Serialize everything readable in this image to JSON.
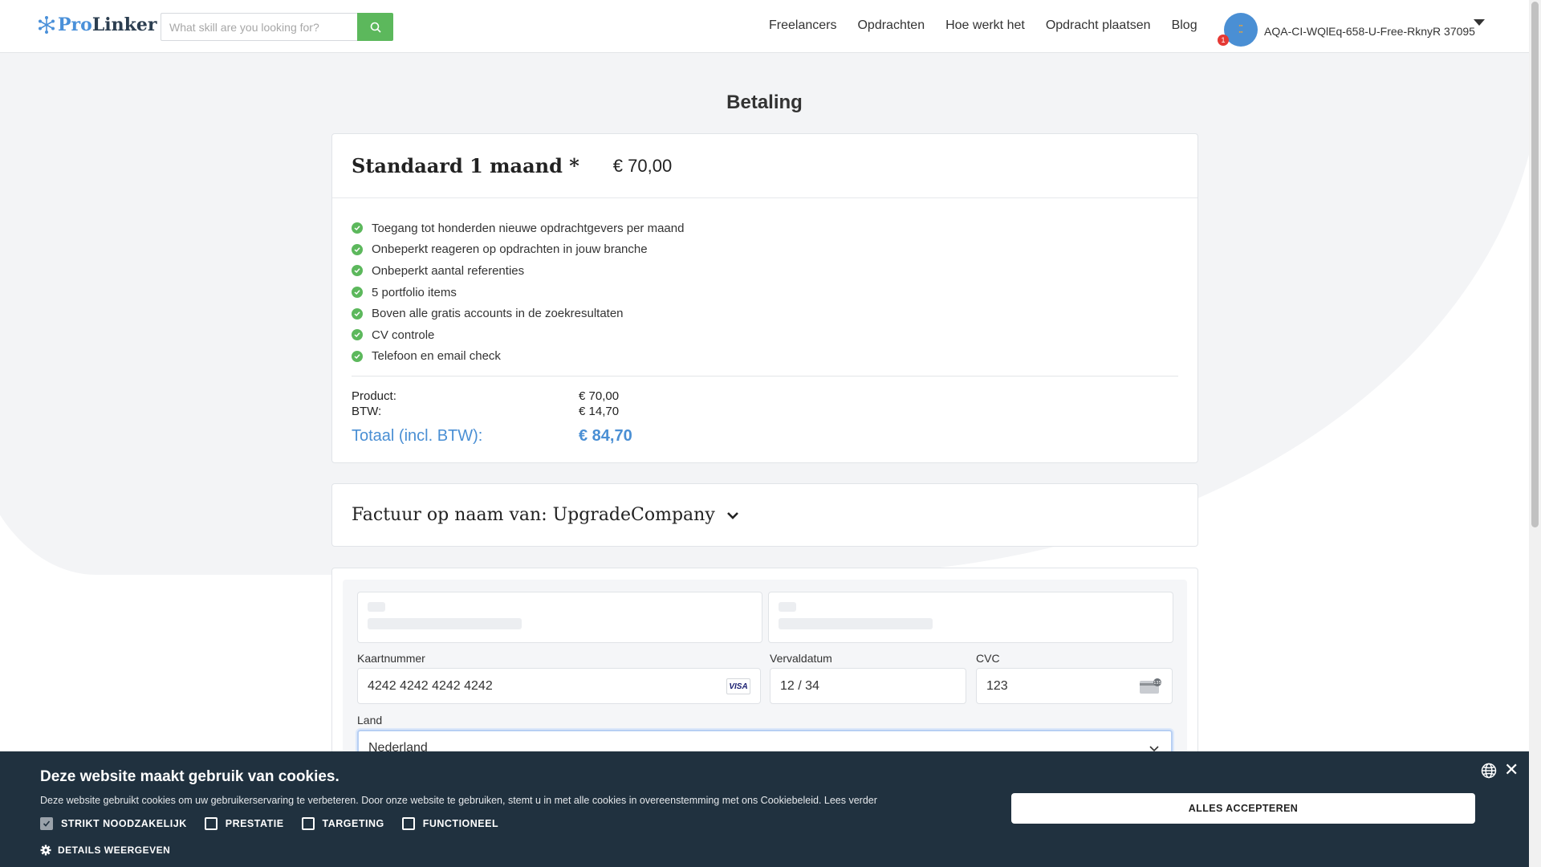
{
  "header": {
    "logo_pro": "Pro",
    "logo_linker": "Linker",
    "search_placeholder": "What skill are you looking for?",
    "nav": [
      "Freelancers",
      "Opdrachten",
      "Hoe werkt het",
      "Opdracht plaatsen",
      "Blog"
    ],
    "notification_count": "1",
    "username": "AQA-CI-WQlEq-658-U-Free-RknyR 37095"
  },
  "page": {
    "title": "Betaling"
  },
  "product": {
    "name": "Standaard 1 maand *",
    "price": "€ 70,00",
    "features": [
      "Toegang tot honderden nieuwe opdrachtgevers per maand",
      "Onbeperkt reageren op opdrachten in jouw branche",
      "Onbeperkt aantal referenties",
      "5 portfolio items",
      "Boven alle gratis accounts in de zoekresultaten",
      "CV controle",
      "Telefoon en email check"
    ],
    "totals": {
      "product_label": "Product:",
      "product_value": "€ 70,00",
      "btw_label": "BTW:",
      "btw_value": "€ 14,70",
      "total_label": "Totaal (incl. BTW):",
      "total_value": "€ 84,70"
    }
  },
  "invoice": {
    "label": "Factuur op naam van: UpgradeCompany"
  },
  "payment": {
    "card_number_label": "Kaartnummer",
    "card_number_value": "4242 4242 4242 4242",
    "card_brand": "VISA",
    "expiry_label": "Vervaldatum",
    "expiry_value": "12 / 34",
    "cvc_label": "CVC",
    "cvc_value": "123",
    "country_label": "Land",
    "country_value": "Nederland"
  },
  "cookie": {
    "title": "Deze website maakt gebruik van cookies.",
    "text": "Deze website gebruikt cookies om uw gebruikerservaring te verbeteren. Door onze website te gebruiken, stemt u in met alle cookies in overeenstemming met ons Cookiebeleid. Lees verder",
    "options": [
      {
        "label": "STRIKT NOODZAKELIJK",
        "checked": true
      },
      {
        "label": "PRESTATIE",
        "checked": false
      },
      {
        "label": "TARGETING",
        "checked": false
      },
      {
        "label": "FUNCTIONEEL",
        "checked": false
      }
    ],
    "details": "DETAILS WEERGEVEN",
    "accept": "ALLES ACCEPTEREN"
  },
  "colors": {
    "accent_green": "#5cb85c",
    "accent_blue": "#4a8fd4",
    "cookie_bg": "#20313f"
  }
}
